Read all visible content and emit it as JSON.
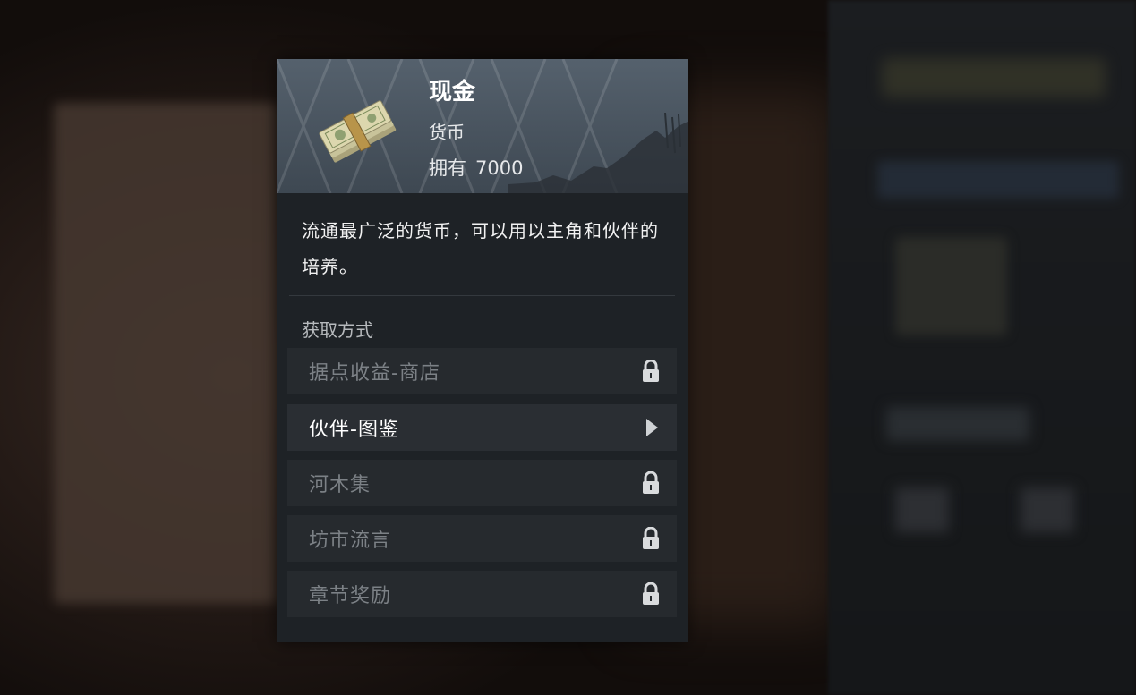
{
  "item": {
    "name": "现金",
    "type": "货币",
    "owned_label": "拥有",
    "owned_count": "7000",
    "description": "流通最广泛的货币，可以用以主角和伙伴的培养。"
  },
  "sources": {
    "label": "获取方式",
    "items": [
      {
        "label": "据点收益-商店",
        "state": "locked",
        "icon": "lock-icon"
      },
      {
        "label": "伙伴-图鉴",
        "state": "available",
        "icon": "chevron-right-icon"
      },
      {
        "label": "河木集",
        "state": "locked",
        "icon": "lock-icon"
      },
      {
        "label": "坊市流言",
        "state": "locked",
        "icon": "lock-icon"
      },
      {
        "label": "章节奖励",
        "state": "locked",
        "icon": "lock-icon"
      }
    ]
  },
  "colors": {
    "header": "#4e5a66",
    "panel": "#1e2226",
    "row": "#262a2e",
    "locked_text": "#7c8186",
    "active_text": "#ffffff"
  }
}
